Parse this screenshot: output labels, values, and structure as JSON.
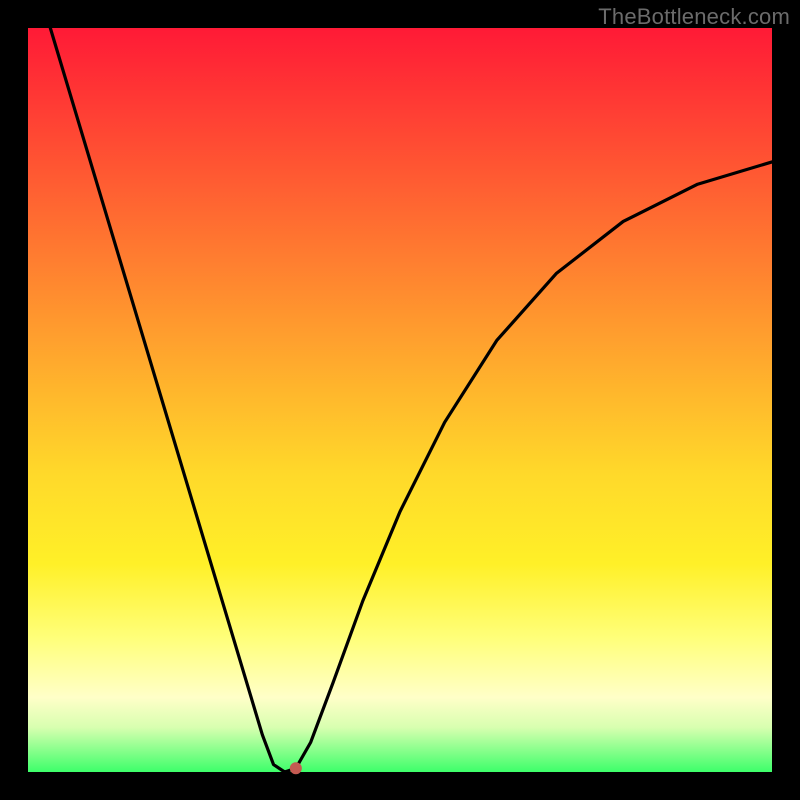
{
  "watermark": "TheBottleneck.com",
  "chart_data": {
    "type": "line",
    "title": "",
    "xlabel": "",
    "ylabel": "",
    "xlim": [
      0,
      100
    ],
    "ylim": [
      0,
      100
    ],
    "series": [
      {
        "name": "bottleneck-curve",
        "x": [
          3,
          6,
          9,
          12,
          15,
          18,
          21,
          24,
          27,
          30,
          31.5,
          33,
          34.5,
          36,
          38,
          41,
          45,
          50,
          56,
          63,
          71,
          80,
          90,
          100
        ],
        "values": [
          100,
          90,
          80,
          70,
          60,
          50,
          40,
          30,
          20,
          10,
          5,
          1,
          0,
          0.5,
          4,
          12,
          23,
          35,
          47,
          58,
          67,
          74,
          79,
          82
        ]
      }
    ],
    "marker": {
      "x": 36,
      "y": 0.5,
      "color": "#c45a52",
      "radius_px": 6
    },
    "gradient_stops": [
      {
        "pos": 0,
        "color": "#ff1a36"
      },
      {
        "pos": 10,
        "color": "#ff3a34"
      },
      {
        "pos": 20,
        "color": "#ff5a32"
      },
      {
        "pos": 30,
        "color": "#ff7a30"
      },
      {
        "pos": 40,
        "color": "#ff9a2e"
      },
      {
        "pos": 50,
        "color": "#ffba2c"
      },
      {
        "pos": 60,
        "color": "#ffd92a"
      },
      {
        "pos": 72,
        "color": "#fff028"
      },
      {
        "pos": 82,
        "color": "#ffff7a"
      },
      {
        "pos": 90,
        "color": "#ffffc8"
      },
      {
        "pos": 94,
        "color": "#d8ffb0"
      },
      {
        "pos": 100,
        "color": "#3dff6a"
      }
    ]
  }
}
